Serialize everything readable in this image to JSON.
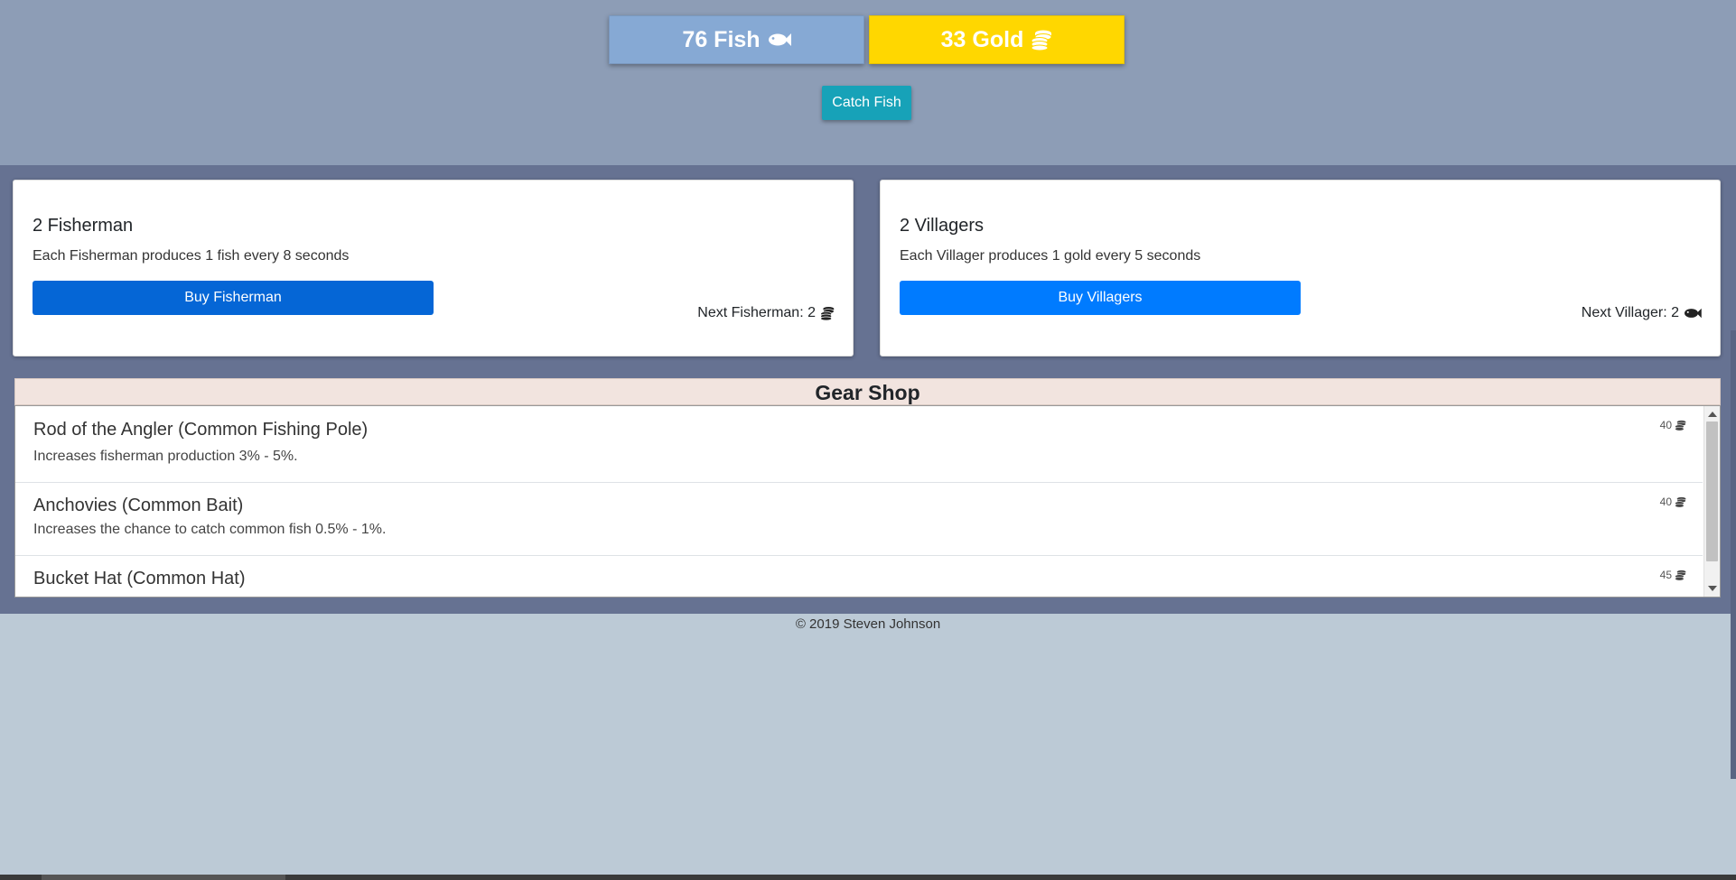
{
  "resources": {
    "fish": {
      "text": "76 Fish",
      "icon": "fish-icon",
      "color": "#86a9d4"
    },
    "gold": {
      "text": "33 Gold",
      "icon": "coins-icon",
      "color": "#ffd700"
    }
  },
  "actions": {
    "catch_label": "Catch Fish"
  },
  "workers": {
    "fisherman": {
      "title": "2 Fisherman",
      "desc": "Each Fisherman produces 1 fish every 8 seconds",
      "button": "Buy Fisherman",
      "next": "Next Fisherman: 2",
      "next_icon": "coins-icon"
    },
    "villager": {
      "title": "2 Villagers",
      "desc": "Each Villager produces 1 gold every 5 seconds",
      "button": "Buy Villagers",
      "next": "Next Villager: 2",
      "next_icon": "fish-icon"
    }
  },
  "shop": {
    "title": "Gear Shop",
    "items": [
      {
        "name": "Rod of the Angler (Common Fishing Pole)",
        "desc": "Increases fisherman production 3% - 5%.",
        "cost": "40",
        "cost_icon": "coins-icon"
      },
      {
        "name": "Anchovies (Common Bait)",
        "desc": "Increases the chance to catch common fish 0.5% - 1%.",
        "cost": "40",
        "cost_icon": "coins-icon"
      },
      {
        "name": "Bucket Hat (Common Hat)",
        "desc": "",
        "cost": "45",
        "cost_icon": "coins-icon"
      }
    ]
  },
  "footer": {
    "copyright": "© 2019 Steven Johnson"
  },
  "colors": {
    "top_band": "#8d9db6",
    "mid_band": "#667292",
    "page_bg": "#bccad6",
    "catch_button": "#17a2b8",
    "buy_fisherman": "#0566d6",
    "buy_villagers": "#007bff",
    "shop_header": "#f2e4df"
  }
}
